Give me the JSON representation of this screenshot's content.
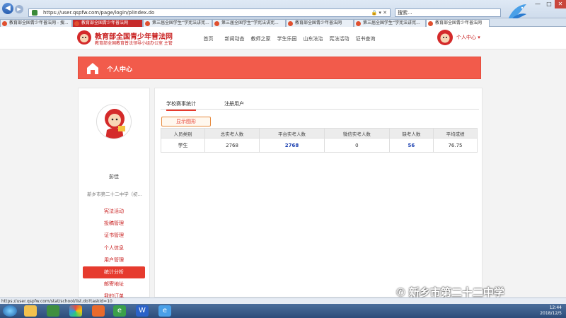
{
  "browser": {
    "url": "https://user.qspfw.com/page/login/plIndex.do",
    "search_placeholder": "搜索...",
    "tabs": [
      {
        "label": "教育部全国青少年普法网 - 搜...",
        "style": "plain"
      },
      {
        "label": "教育部全国青少年普法网",
        "style": "red"
      },
      {
        "label": "第三届全国学生“学宪法讲宪...",
        "style": "plain"
      },
      {
        "label": "第三届全国学生“学宪法讲宪...",
        "style": "plain"
      },
      {
        "label": "教育部全国青少年普法网",
        "style": "plain"
      },
      {
        "label": "第三届全国学生“学宪法讲宪...",
        "style": "plain"
      },
      {
        "label": "教育部全国青少年普法网",
        "style": "selected"
      }
    ],
    "status_url": "https://user.qspfw.com/stat/school/list.do?taskId=10"
  },
  "site": {
    "title": "教育部全国青少年普法网",
    "subtitle": "教育部全国教育普法领导小组办公室 主管",
    "nav": [
      "首页",
      "新闻动态",
      "教师之家",
      "学生乐园",
      "山东法治",
      "宪法活动",
      "证书查询"
    ],
    "user_center": "个人中心"
  },
  "banner": {
    "title": "个人中心"
  },
  "profile": {
    "name": "彭佳",
    "school": "新乡市第二十二中学（初..."
  },
  "menu": [
    {
      "label": "宪法活动",
      "active": false
    },
    {
      "label": "投稿管理",
      "active": false
    },
    {
      "label": "证书管理",
      "active": false
    },
    {
      "label": "个人信息",
      "active": false
    },
    {
      "label": "用户管理",
      "active": false
    },
    {
      "label": "统计分析",
      "active": true
    },
    {
      "label": "邮寄地址",
      "active": false
    },
    {
      "label": "我的订单",
      "active": false
    }
  ],
  "main": {
    "tabs": [
      "学校赛事统计",
      "注册用户"
    ],
    "show_chart_label": "显示图形",
    "table": {
      "headers": [
        "人员类别",
        "总实考人数",
        "平台实考人数",
        "微信实考人数",
        "缺考人数",
        "平均成绩"
      ],
      "rows": [
        [
          "学生",
          "2768",
          "2768",
          "0",
          "56",
          "76.75"
        ]
      ]
    }
  },
  "taskbar": {
    "time": "12:44",
    "date": "2018/12/5"
  },
  "watermark": "新乡市第二十二中学",
  "colors": {
    "brand_red": "#c81e1e",
    "banner_red": "#f25b4b",
    "link_blue": "#1a3fb0"
  }
}
